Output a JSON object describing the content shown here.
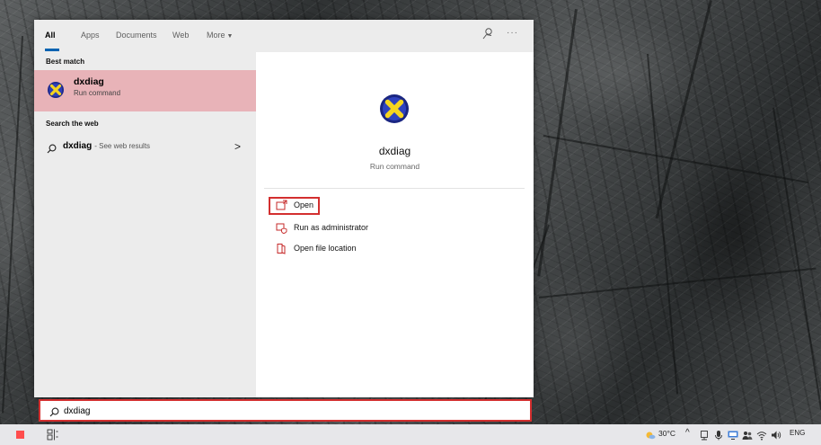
{
  "filter_tabs": [
    {
      "label": "All",
      "active": true
    },
    {
      "label": "Apps",
      "active": false
    },
    {
      "label": "Documents",
      "active": false
    },
    {
      "label": "Web",
      "active": false
    },
    {
      "label": "More",
      "active": false
    }
  ],
  "icons": {
    "feedback": "feedback-icon",
    "more": "more-options-icon",
    "app": "dxdiag-icon",
    "search": "search-icon",
    "open": "open-icon",
    "run_admin": "shield-run-icon",
    "file_location": "folder-icon"
  },
  "more_options_label": "···",
  "results": {
    "best_match_header": "Best match",
    "best_match": {
      "title": "dxdiag",
      "subtitle": "Run command"
    },
    "search_web_header": "Search the web",
    "web_result": {
      "query": "dxdiag",
      "suffix": "- See web results",
      "chevron": ">"
    }
  },
  "detail": {
    "title": "dxdiag",
    "subtitle": "Run command",
    "actions": [
      {
        "label": "Open"
      },
      {
        "label": "Run as administrator"
      },
      {
        "label": "Open file location"
      }
    ]
  },
  "search_box": {
    "value": "dxdiag"
  },
  "taskbar": {
    "weather": "30°C",
    "chevron": "^",
    "language": "ENG"
  },
  "colors": {
    "accent": "#0063b1",
    "selection": "#e8b3b8",
    "highlight_border": "#d32f2f",
    "start": "#ff4d4d"
  }
}
